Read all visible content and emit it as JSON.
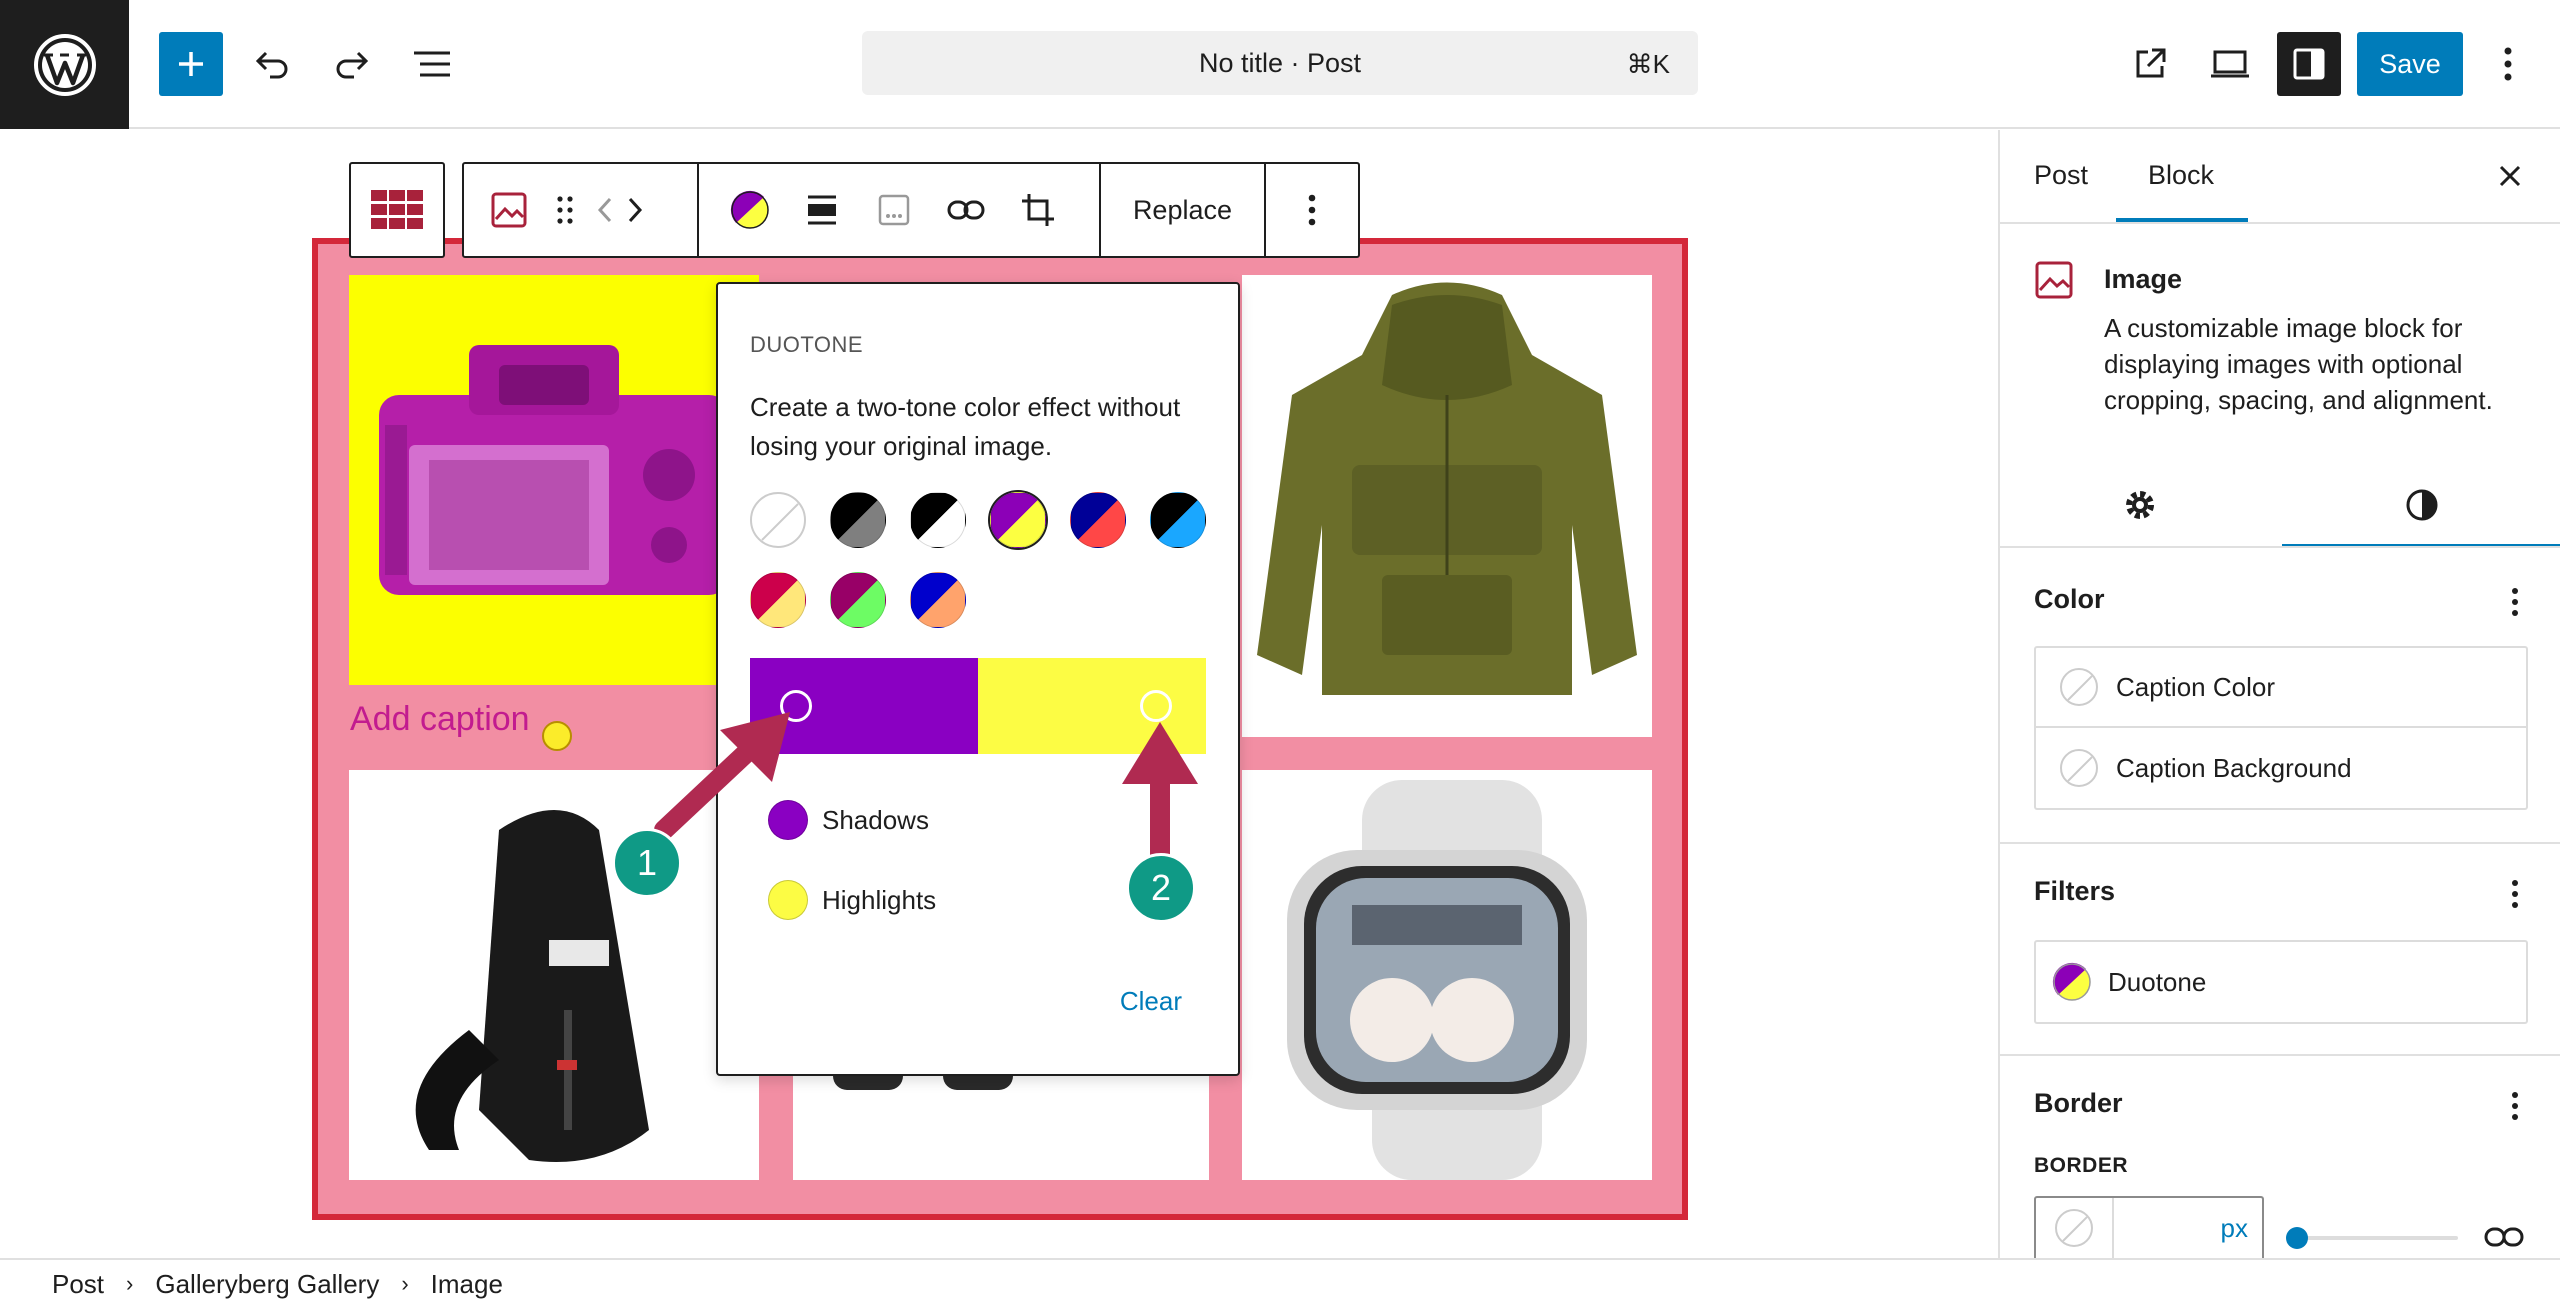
{
  "header": {
    "doc_title": "No title · Post",
    "shortcut": "⌘K",
    "save_label": "Save"
  },
  "block_toolbar": {
    "replace_label": "Replace"
  },
  "duotone": {
    "heading": "DUOTONE",
    "description": "Create a two-tone color effect without losing your original image.",
    "shadows_label": "Shadows",
    "highlights_label": "Highlights",
    "clear_label": "Clear",
    "shadow_color": "#8a00c2",
    "highlight_color": "#fcfc44",
    "presets": [
      [
        "#ffffff",
        "#ffffff"
      ],
      [
        "#000000",
        "#7f7f7f"
      ],
      [
        "#000000",
        "#ffffff"
      ],
      [
        "#8c00b7",
        "#fcff41"
      ],
      [
        "#000097",
        "#ff4747"
      ],
      [
        "#000000",
        "#1aa7ff"
      ],
      [
        "#cc004b",
        "#ffe77a"
      ],
      [
        "#980067",
        "#6dfc64"
      ],
      [
        "#0000cc",
        "#ffa36c"
      ]
    ]
  },
  "canvas": {
    "caption_placeholder": "Add caption"
  },
  "markers": [
    "1",
    "2"
  ],
  "sidebar": {
    "tab_post": "Post",
    "tab_block": "Block",
    "block_title": "Image",
    "block_description": "A customizable image block for displaying images with optional cropping, spacing, and alignment.",
    "color_panel_title": "Color",
    "caption_color": "Caption Color",
    "caption_background": "Caption Background",
    "filters_panel_title": "Filters",
    "duotone_label": "Duotone",
    "border_panel_title": "Border",
    "border_sublabel": "BORDER",
    "unit": "px"
  },
  "breadcrumb": [
    "Post",
    "Galleryberg Gallery",
    "Image"
  ],
  "colors": {
    "accent": "#007cba",
    "gallery_bg": "#f28ea3",
    "gallery_border": "#d4283a",
    "arrow": "#b02a51"
  }
}
